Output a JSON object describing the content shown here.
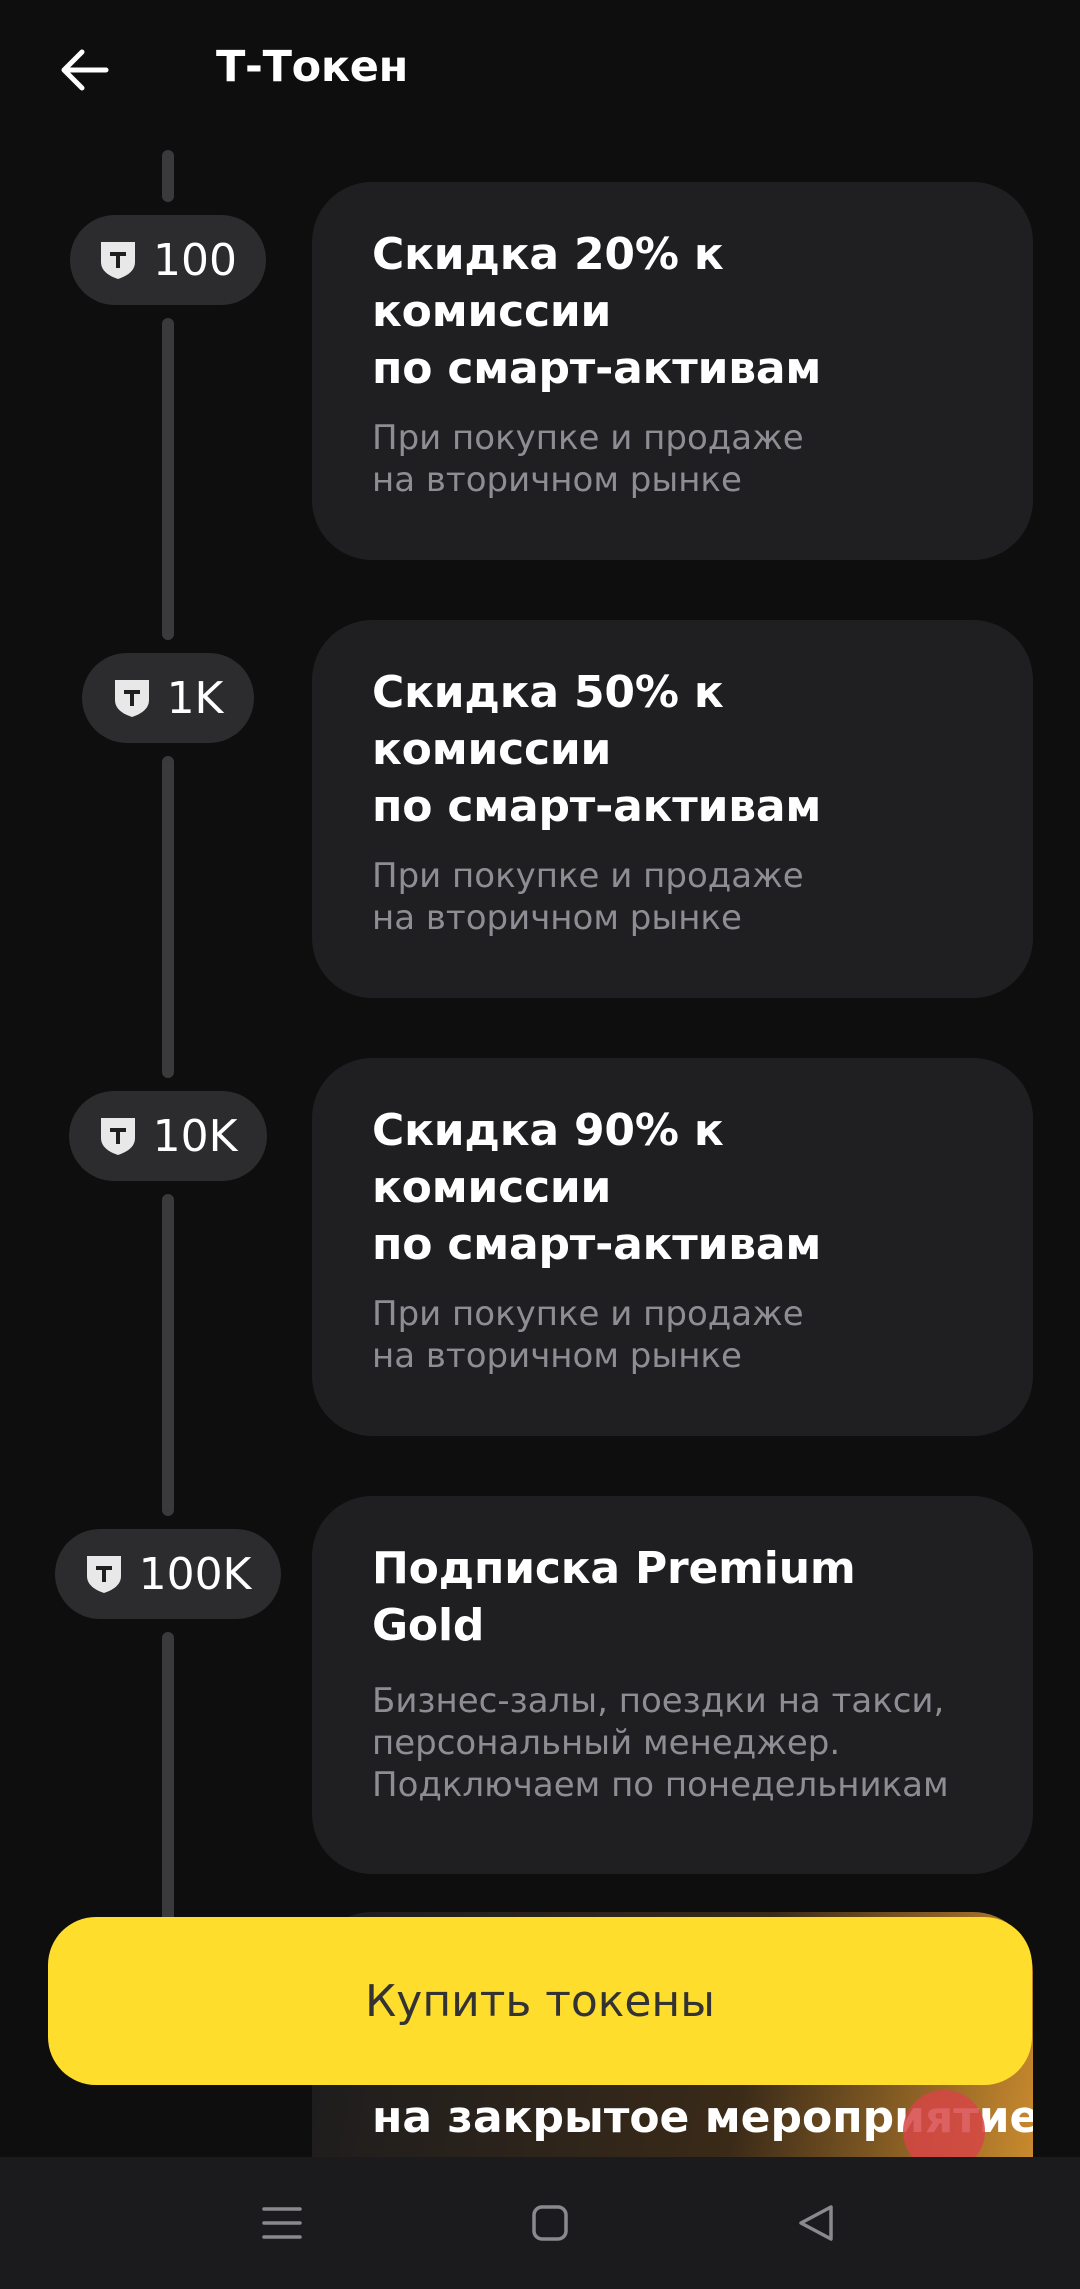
{
  "header": {
    "title": "Т-Токен",
    "back_icon": "arrow-left-icon"
  },
  "tiers": [
    {
      "amount": "100",
      "icon": "t-shield-icon",
      "title": "Скидка 20% к комиссии\nпо смарт-активам",
      "description": "При покупке и продаже\nна вторичном рынке"
    },
    {
      "amount": "1K",
      "icon": "t-shield-icon",
      "title": "Скидка 50% к комиссии\nпо смарт-активам",
      "description": "При покупке и продаже\nна вторичном рынке"
    },
    {
      "amount": "10K",
      "icon": "t-shield-icon",
      "title": "Скидка 90% к комиссии\nпо смарт-активам",
      "description": "При покупке и продаже\nна вторичном рынке"
    },
    {
      "amount": "100K",
      "icon": "t-shield-icon",
      "title": "Подписка Premium Gold",
      "description": "Бизнес-залы, поездки на такси,\nперсональный менеджер.\nПодключаем по понедельникам"
    }
  ],
  "promo": {
    "title_visible": "на закрытое мероприятие"
  },
  "buy_button": {
    "label": "Купить токены",
    "color": "#ffdd2d"
  },
  "navbar": {
    "icons": [
      "menu-icon",
      "home-square-icon",
      "back-triangle-icon"
    ]
  }
}
